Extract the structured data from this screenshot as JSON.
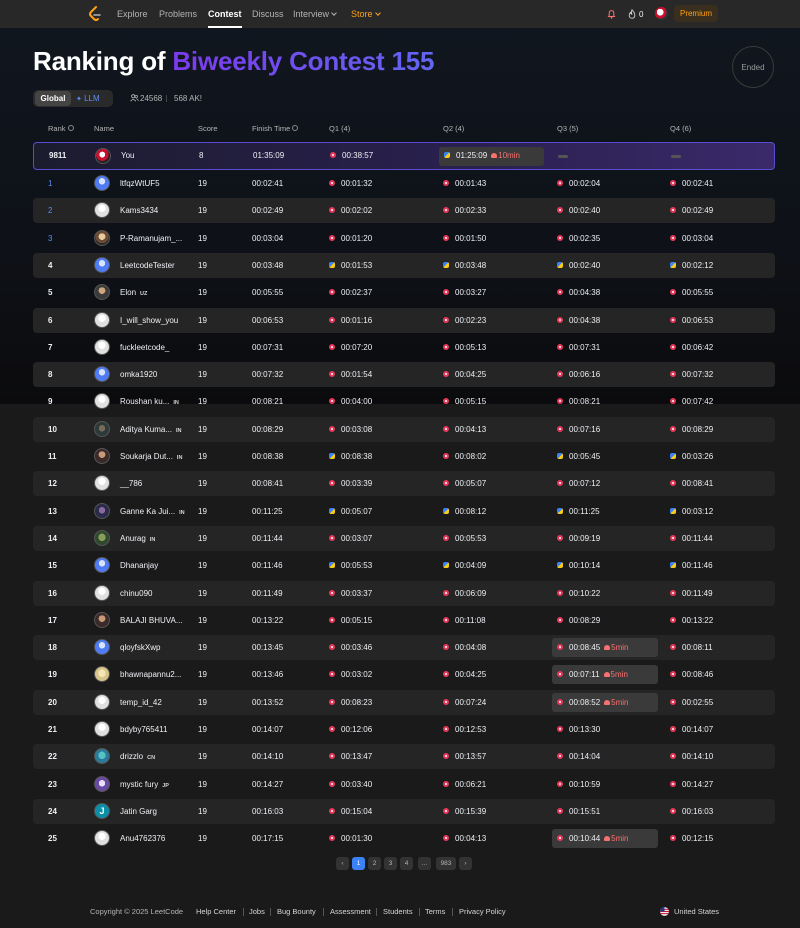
{
  "nav": {
    "items": [
      "Explore",
      "Problems",
      "Contest",
      "Discuss",
      "Interview",
      "Store"
    ],
    "active": "Contest",
    "streak_count": "0",
    "premium_label": "Premium"
  },
  "hero": {
    "title_prefix": "Ranking of ",
    "title_contest": "Biweekly Contest 155",
    "status": "Ended",
    "tabs": [
      "Global",
      "LLM"
    ],
    "participants": "24568",
    "ak_count": "568 AK!"
  },
  "table": {
    "headers": [
      "Rank",
      "Name",
      "Score",
      "Finish Time",
      "Q1 (4)",
      "Q2 (4)",
      "Q3 (5)",
      "Q4 (6)"
    ],
    "me": {
      "rank": "9811",
      "name": "You",
      "score": "8",
      "finish": "01:35:09",
      "q1": "00:38:57",
      "q1_lang": "cpp",
      "q2": "01:25:09",
      "q2_lang": "py",
      "q2_penalty": "10min"
    },
    "rows": [
      {
        "rank": "1",
        "name": "ltfqzWtUF5",
        "flag": "",
        "score": "19",
        "finish": "00:02:41",
        "q1": "00:01:32",
        "q2": "00:01:43",
        "q3": "00:02:04",
        "q4": "00:02:41",
        "langs": [
          "cpp",
          "cpp",
          "cpp",
          "cpp"
        ],
        "avatar": "blue"
      },
      {
        "rank": "2",
        "name": "Kams3434",
        "flag": "",
        "score": "19",
        "finish": "00:02:49",
        "q1": "00:02:02",
        "q2": "00:02:33",
        "q3": "00:02:40",
        "q4": "00:02:49",
        "langs": [
          "cpp",
          "cpp",
          "cpp",
          "cpp"
        ],
        "avatar": "default"
      },
      {
        "rank": "3",
        "name": "P-Ramanujam_...",
        "flag": "",
        "score": "19",
        "finish": "00:03:04",
        "q1": "00:01:20",
        "q2": "00:01:50",
        "q3": "00:02:35",
        "q4": "00:03:04",
        "langs": [
          "cpp",
          "cpp",
          "cpp",
          "cpp"
        ],
        "avatar": "photo1"
      },
      {
        "rank": "4",
        "name": "LeetcodeTester",
        "flag": "",
        "score": "19",
        "finish": "00:03:48",
        "q1": "00:01:53",
        "q2": "00:03:48",
        "q3": "00:02:40",
        "q4": "00:02:12",
        "langs": [
          "py",
          "py",
          "py",
          "py"
        ],
        "avatar": "blue"
      },
      {
        "rank": "5",
        "name": "Elon",
        "flag": "UZ",
        "score": "19",
        "finish": "00:05:55",
        "q1": "00:02:37",
        "q2": "00:03:27",
        "q3": "00:04:38",
        "q4": "00:05:55",
        "langs": [
          "cpp",
          "cpp",
          "cpp",
          "cpp"
        ],
        "avatar": "photo2"
      },
      {
        "rank": "6",
        "name": "I_will_show_you",
        "flag": "",
        "score": "19",
        "finish": "00:06:53",
        "q1": "00:01:16",
        "q2": "00:02:23",
        "q3": "00:04:38",
        "q4": "00:06:53",
        "langs": [
          "cpp",
          "cpp",
          "cpp",
          "cpp"
        ],
        "avatar": "default"
      },
      {
        "rank": "7",
        "name": "fuckleetcode_",
        "flag": "",
        "score": "19",
        "finish": "00:07:31",
        "q1": "00:07:20",
        "q2": "00:05:13",
        "q3": "00:07:31",
        "q4": "00:06:42",
        "langs": [
          "cpp",
          "cpp",
          "cpp",
          "cpp"
        ],
        "avatar": "default"
      },
      {
        "rank": "8",
        "name": "omka1920",
        "flag": "",
        "score": "19",
        "finish": "00:07:32",
        "q1": "00:01:54",
        "q2": "00:04:25",
        "q3": "00:06:16",
        "q4": "00:07:32",
        "langs": [
          "cpp",
          "cpp",
          "cpp",
          "cpp"
        ],
        "avatar": "blue"
      },
      {
        "rank": "9",
        "name": "Roushan ku...",
        "flag": "IN",
        "score": "19",
        "finish": "00:08:21",
        "q1": "00:04:00",
        "q2": "00:05:15",
        "q3": "00:08:21",
        "q4": "00:07:42",
        "langs": [
          "cpp",
          "cpp",
          "cpp",
          "cpp"
        ],
        "avatar": "default"
      },
      {
        "rank": "10",
        "name": "Aditya Kuma...",
        "flag": "IN",
        "score": "19",
        "finish": "00:08:29",
        "q1": "00:03:08",
        "q2": "00:04:13",
        "q3": "00:07:16",
        "q4": "00:08:29",
        "langs": [
          "cpp",
          "cpp",
          "cpp",
          "cpp"
        ],
        "avatar": "photo3"
      },
      {
        "rank": "11",
        "name": "Soukarja Dut...",
        "flag": "IN",
        "score": "19",
        "finish": "00:08:38",
        "q1": "00:08:38",
        "q2": "00:08:02",
        "q3": "00:05:45",
        "q4": "00:03:26",
        "langs": [
          "py",
          "cpp",
          "py",
          "py"
        ],
        "avatar": "photo9"
      },
      {
        "rank": "12",
        "name": "__786",
        "flag": "",
        "score": "19",
        "finish": "00:08:41",
        "q1": "00:03:39",
        "q2": "00:05:07",
        "q3": "00:07:12",
        "q4": "00:08:41",
        "langs": [
          "cpp",
          "cpp",
          "cpp",
          "cpp"
        ],
        "avatar": "default"
      },
      {
        "rank": "13",
        "name": "Ganne Ka Jui...",
        "flag": "IN",
        "score": "19",
        "finish": "00:11:25",
        "q1": "00:05:07",
        "q2": "00:08:12",
        "q3": "00:11:25",
        "q4": "00:03:12",
        "langs": [
          "py",
          "py",
          "py",
          "py"
        ],
        "avatar": "photo8"
      },
      {
        "rank": "14",
        "name": "Anurag",
        "flag": "IN",
        "score": "19",
        "finish": "00:11:44",
        "q1": "00:03:07",
        "q2": "00:05:53",
        "q3": "00:09:19",
        "q4": "00:11:44",
        "langs": [
          "cpp",
          "cpp",
          "cpp",
          "cpp"
        ],
        "avatar": "photo4"
      },
      {
        "rank": "15",
        "name": "Dhananjay",
        "flag": "",
        "score": "19",
        "finish": "00:11:46",
        "q1": "00:05:53",
        "q2": "00:04:09",
        "q3": "00:10:14",
        "q4": "00:11:46",
        "langs": [
          "py",
          "py",
          "py",
          "py"
        ],
        "avatar": "blue"
      },
      {
        "rank": "16",
        "name": "chinu090",
        "flag": "",
        "score": "19",
        "finish": "00:11:49",
        "q1": "00:03:37",
        "q2": "00:06:09",
        "q3": "00:10:22",
        "q4": "00:11:49",
        "langs": [
          "cpp",
          "cpp",
          "cpp",
          "cpp"
        ],
        "avatar": "default"
      },
      {
        "rank": "17",
        "name": "BALAJI BHUVA...",
        "flag": "",
        "score": "19",
        "finish": "00:13:22",
        "q1": "00:05:15",
        "q2": "00:11:08",
        "q3": "00:08:29",
        "q4": "00:13:22",
        "langs": [
          "cpp",
          "cpp",
          "cpp",
          "cpp"
        ],
        "avatar": "photo9"
      },
      {
        "rank": "18",
        "name": "qloyfskXwp",
        "flag": "",
        "score": "19",
        "finish": "00:13:45",
        "q1": "00:03:46",
        "q2": "00:04:08",
        "q3": "00:08:45",
        "q4": "00:08:11",
        "langs": [
          "cpp",
          "cpp",
          "cpp",
          "cpp"
        ],
        "q3_penalty": "5min",
        "avatar": "blue"
      },
      {
        "rank": "19",
        "name": "bhawnapannu2...",
        "flag": "",
        "score": "19",
        "finish": "00:13:46",
        "q1": "00:03:02",
        "q2": "00:04:25",
        "q3": "00:07:11",
        "q4": "00:08:46",
        "langs": [
          "cpp",
          "cpp",
          "cpp",
          "cpp"
        ],
        "q3_penalty": "5min",
        "avatar": "photo5"
      },
      {
        "rank": "20",
        "name": "temp_id_42",
        "flag": "",
        "score": "19",
        "finish": "00:13:52",
        "q1": "00:08:23",
        "q2": "00:07:24",
        "q3": "00:08:52",
        "q4": "00:02:55",
        "langs": [
          "cpp",
          "cpp",
          "cpp",
          "cpp"
        ],
        "q3_penalty": "5min",
        "avatar": "default"
      },
      {
        "rank": "21",
        "name": "bdyby765411",
        "flag": "",
        "score": "19",
        "finish": "00:14:07",
        "q1": "00:12:06",
        "q2": "00:12:53",
        "q3": "00:13:30",
        "q4": "00:14:07",
        "langs": [
          "cpp",
          "cpp",
          "cpp",
          "cpp"
        ],
        "avatar": "default"
      },
      {
        "rank": "22",
        "name": "drizzlo",
        "flag": "CN",
        "score": "19",
        "finish": "00:14:10",
        "q1": "00:13:47",
        "q2": "00:13:57",
        "q3": "00:14:04",
        "q4": "00:14:10",
        "langs": [
          "cpp",
          "cpp",
          "cpp",
          "cpp"
        ],
        "avatar": "photo6"
      },
      {
        "rank": "23",
        "name": "mystic fury",
        "flag": "JP",
        "score": "19",
        "finish": "00:14:27",
        "q1": "00:03:40",
        "q2": "00:06:21",
        "q3": "00:10:59",
        "q4": "00:14:27",
        "langs": [
          "cpp",
          "cpp",
          "cpp",
          "cpp"
        ],
        "avatar": "photo7"
      },
      {
        "rank": "24",
        "name": "Jatin Garg",
        "flag": "",
        "score": "19",
        "finish": "00:16:03",
        "q1": "00:15:04",
        "q2": "00:15:39",
        "q3": "00:15:51",
        "q4": "00:16:03",
        "langs": [
          "cpp",
          "cpp",
          "cpp",
          "cpp"
        ],
        "avatar": "teal",
        "avatar_letter": "J"
      },
      {
        "rank": "25",
        "name": "Anu4762376",
        "flag": "",
        "score": "19",
        "finish": "00:17:15",
        "q1": "00:01:30",
        "q2": "00:04:13",
        "q3": "00:10:44",
        "q4": "00:12:15",
        "langs": [
          "cpp",
          "cpp",
          "cpp",
          "cpp"
        ],
        "q3_penalty": "5min",
        "avatar": "default"
      }
    ]
  },
  "pagination": {
    "pages": [
      "1",
      "2",
      "3",
      "4",
      "...",
      "983"
    ],
    "active": "1"
  },
  "footer": {
    "copyright": "Copyright © 2025 LeetCode",
    "links": [
      "Help Center",
      "Jobs",
      "Bug Bounty",
      "Assessment",
      "Students",
      "Terms",
      "Privacy Policy"
    ],
    "region": "United States"
  },
  "colors": {
    "accent": "#ffa116",
    "link_blue": "#5b8ff9",
    "penalty_red": "#f87171",
    "title_purple": "#7c3aed"
  }
}
